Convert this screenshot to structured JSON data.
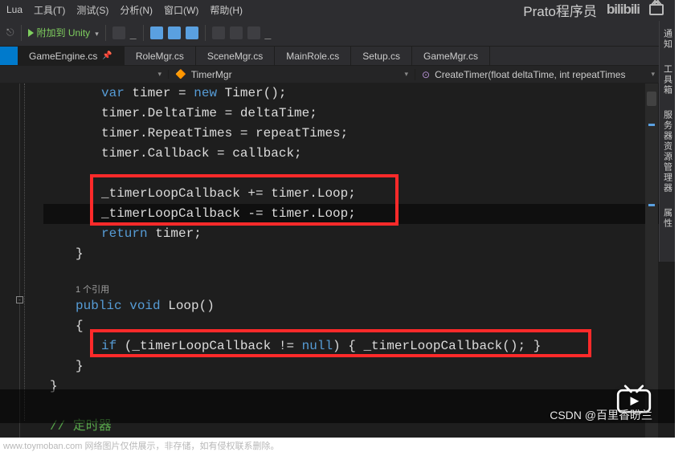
{
  "menu": {
    "lua": "Lua",
    "tools": "工具(T)",
    "test": "测试(S)",
    "analyze": "分析(N)",
    "window": "窗口(W)",
    "help": "帮助(H)"
  },
  "brand": {
    "title": "Prato程序员",
    "bili": "bilibili"
  },
  "toolbar": {
    "attach_label": "附加到 Unity"
  },
  "tabs": [
    {
      "label": "GameEngine.cs",
      "active": true
    },
    {
      "label": "RoleMgr.cs"
    },
    {
      "label": "SceneMgr.cs"
    },
    {
      "label": "MainRole.cs"
    },
    {
      "label": "Setup.cs"
    },
    {
      "label": "GameMgr.cs"
    }
  ],
  "nav": {
    "class_name": "TimerMgr",
    "method_sig": "CreateTimer(float deltaTime, int repeatTimes"
  },
  "code": {
    "l1_a": "var",
    "l1_b": " timer = ",
    "l1_c": "new",
    "l1_d": " Timer();",
    "l2": "timer.DeltaTime = deltaTime;",
    "l3": "timer.RepeatTimes = repeatTimes;",
    "l4": "timer.Callback = callback;",
    "l6a": "_timerLoopCallback += timer.Loop;",
    "l7a": "_timerLoopCallback -= timer.Loop;",
    "l8_a": "return",
    "l8_b": " timer;",
    "l9": "}",
    "codelens": "1 个引用",
    "l11_a": "public",
    "l11_b": " void",
    "l11_c": " Loop()",
    "l12": "{",
    "l13_a": "if",
    "l13_b": " (_timerLoopCallback != ",
    "l13_c": "null",
    "l13_d": ") { _timerLoopCallback(); }",
    "l14": "}",
    "l15": "}",
    "l17": "// 定时器"
  },
  "right_tabs": {
    "t1": "通知",
    "t2": "工具箱",
    "t3": "服务器资源管理器",
    "t4": "属性"
  },
  "watermark": {
    "csdn": "CSDN @百里香盼兰"
  },
  "footer": {
    "note": "www.toymoban.com 网络图片仅供展示，非存储，如有侵权联系删除。"
  }
}
